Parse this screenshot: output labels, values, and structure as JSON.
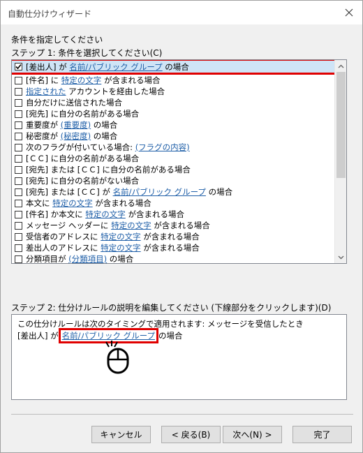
{
  "window": {
    "title": "自動仕分けウィザード"
  },
  "heading": "条件を指定してください",
  "step1": {
    "label": "ステップ 1: 条件を選択してください(C)"
  },
  "conditions": [
    {
      "checked": true,
      "parts": [
        "[差出人] が ",
        {
          "link": "名前/パブリック グループ"
        },
        " の場合"
      ]
    },
    {
      "checked": false,
      "parts": [
        "[件名] に ",
        {
          "link": "特定の文字"
        },
        " が含まれる場合"
      ]
    },
    {
      "checked": false,
      "parts": [
        {
          "link": "指定された"
        },
        " アカウントを経由した場合"
      ]
    },
    {
      "checked": false,
      "parts": [
        "自分だけに送信された場合"
      ]
    },
    {
      "checked": false,
      "parts": [
        "[宛先] に自分の名前がある場合"
      ]
    },
    {
      "checked": false,
      "parts": [
        "重要度が ",
        {
          "link": "(重要度)"
        },
        " の場合"
      ]
    },
    {
      "checked": false,
      "parts": [
        "秘密度が ",
        {
          "link": "(秘密度)"
        },
        " の場合"
      ]
    },
    {
      "checked": false,
      "parts": [
        "次のフラグが付いている場合: ",
        {
          "link": "(フラグの内容)"
        }
      ]
    },
    {
      "checked": false,
      "parts": [
        "[ＣＣ] に自分の名前がある場合"
      ]
    },
    {
      "checked": false,
      "parts": [
        "[宛先] または [ＣＣ] に自分の名前がある場合"
      ]
    },
    {
      "checked": false,
      "parts": [
        "[宛先] に自分の名前がない場合"
      ]
    },
    {
      "checked": false,
      "parts": [
        "[宛先] または [ＣＣ] が ",
        {
          "link": "名前/パブリック グループ"
        },
        " の場合"
      ]
    },
    {
      "checked": false,
      "parts": [
        "本文に ",
        {
          "link": "特定の文字"
        },
        " が含まれる場合"
      ]
    },
    {
      "checked": false,
      "parts": [
        "[件名] か本文に ",
        {
          "link": "特定の文字"
        },
        " が含まれる場合"
      ]
    },
    {
      "checked": false,
      "parts": [
        "メッセージ ヘッダーに ",
        {
          "link": "特定の文字"
        },
        " が含まれる場合"
      ]
    },
    {
      "checked": false,
      "parts": [
        "受信者のアドレスに ",
        {
          "link": "特定の文字"
        },
        " が含まれる場合"
      ]
    },
    {
      "checked": false,
      "parts": [
        "差出人のアドレスに ",
        {
          "link": "特定の文字"
        },
        " が含まれる場合"
      ]
    },
    {
      "checked": false,
      "parts": [
        "分類項目が ",
        {
          "link": "(分類項目)"
        },
        " の場合"
      ]
    }
  ],
  "step2": {
    "label": "ステップ 2: 仕分けルールの説明を編集してください (下線部分をクリックします)(D)",
    "line1": "この仕分けルールは次のタイミングで適用されます: メッセージを受信したとき",
    "line2_prefix": "[差出人] が ",
    "line2_link": "名前/パブリック グループ",
    "line2_suffix": " の場合"
  },
  "buttons": {
    "cancel": "キャンセル",
    "back": "< 戻る(B)",
    "next": "次へ(N) >",
    "finish": "完了"
  },
  "colors": {
    "highlight_border": "#e00000",
    "link": "#1f5fa8",
    "selection": "#cfe4f6"
  }
}
